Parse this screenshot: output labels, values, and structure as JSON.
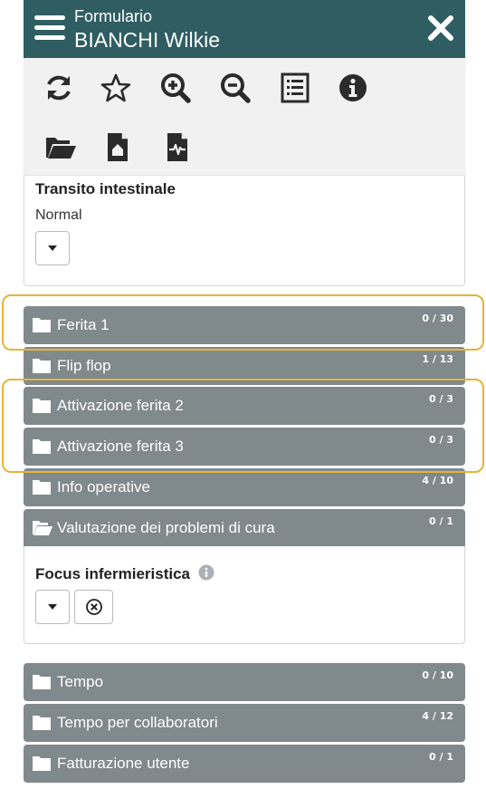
{
  "header": {
    "subtitle": "Formulario",
    "title": "BIANCHI Wilkie",
    "background": "#2f5d62"
  },
  "toolbar": {
    "row1": [
      "refresh-icon",
      "star-icon",
      "zoom-in-icon",
      "zoom-out-icon",
      "list-icon",
      "info-icon"
    ],
    "row2": [
      "folder-open-icon",
      "house-document-icon",
      "medical-document-icon"
    ]
  },
  "transit": {
    "label": "Transito intestinale",
    "value": "Normal"
  },
  "sections": [
    {
      "label": "Ferita 1",
      "count": "0 / 30"
    },
    {
      "label": "Flip flop",
      "count": "1 / 13"
    },
    {
      "label": "Attivazione ferita 2",
      "count": "0 / 3"
    },
    {
      "label": "Attivazione ferita 3",
      "count": "0 / 3"
    },
    {
      "label": "Info operative",
      "count": "4 / 10"
    },
    {
      "label": "Valutazione dei problemi di cura",
      "count": "0 / 1"
    },
    {
      "label": "Tempo",
      "count": "0 / 10"
    },
    {
      "label": "Tempo per collaboratori",
      "count": "4 / 12"
    },
    {
      "label": "Fatturazione utente",
      "count": "0 / 1"
    }
  ],
  "focus": {
    "label": "Focus infermieristica"
  },
  "colors": {
    "section_bar": "#80898b",
    "highlight": "#e6b33a"
  }
}
